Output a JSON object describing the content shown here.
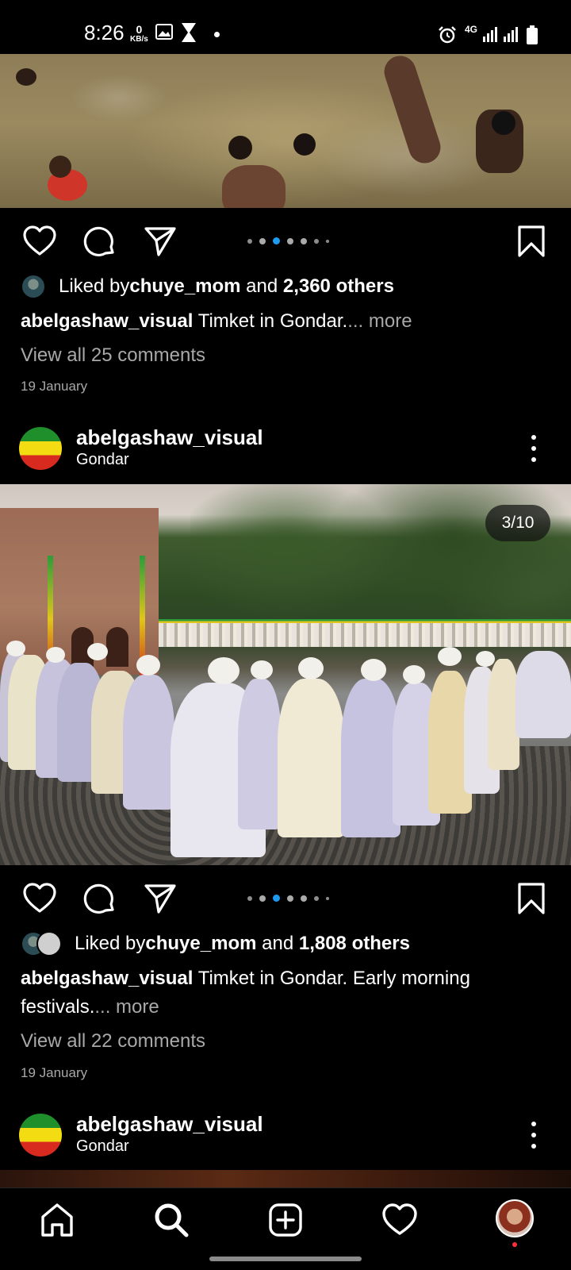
{
  "status_bar": {
    "time": "8:26",
    "net_speed_value": "0",
    "net_speed_unit": "KB/s",
    "network": "4G"
  },
  "post1": {
    "liked_by_prefix": "Liked by ",
    "liked_by_user": "chuye_mom",
    "liked_by_and": " and ",
    "liked_by_others": "2,360 others",
    "caption_user": "abelgashaw_visual",
    "caption_text": " Timket in Gondar.",
    "caption_more": "... more",
    "view_comments": "View all 25 comments",
    "date": "19 January"
  },
  "post2": {
    "username": "abelgashaw_visual",
    "location": "Gondar",
    "image_counter": "3/10",
    "liked_by_prefix": "Liked by ",
    "liked_by_user": "chuye_mom",
    "liked_by_and": " and ",
    "liked_by_others": "1,808 others",
    "caption_user": "abelgashaw_visual",
    "caption_text": " Timket in Gondar. Early morning festivals.",
    "caption_more": "... more",
    "view_comments": "View all 22 comments",
    "date": "19 January"
  },
  "post3": {
    "username": "abelgashaw_visual",
    "location": "Gondar"
  },
  "carousel": {
    "active_index": 2,
    "total_dots": 7,
    "active_color": "#1d9bf0"
  },
  "icons": {
    "like": "heart-outline",
    "comment": "speech-bubble",
    "share": "paper-plane",
    "save": "bookmark",
    "nav": [
      "home",
      "search",
      "create",
      "activity",
      "profile"
    ]
  },
  "colors": {
    "background": "#000000",
    "text": "#ffffff",
    "secondary_text": "#a8a8a8",
    "notification_dot": "#ff3040"
  }
}
